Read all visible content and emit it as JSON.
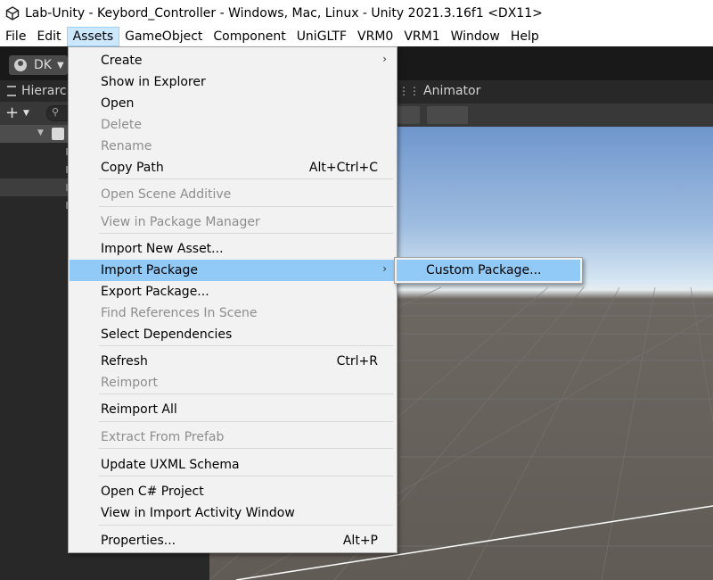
{
  "window": {
    "title": "Lab-Unity - Keybord_Controller - Windows, Mac, Linux - Unity 2021.3.16f1 <DX11>"
  },
  "menubar": {
    "items": [
      "File",
      "Edit",
      "Assets",
      "GameObject",
      "Component",
      "UniGLTF",
      "VRM0",
      "VRM1",
      "Window",
      "Help"
    ],
    "active": "Assets"
  },
  "toolbar": {
    "account_label": "DK"
  },
  "hierarchy": {
    "tab_label": "Hierarc"
  },
  "scene": {
    "animator_tab_label": "Animator"
  },
  "assets_menu": {
    "items": [
      {
        "label": "Create",
        "submenu": true
      },
      {
        "label": "Show in Explorer"
      },
      {
        "label": "Open"
      },
      {
        "label": "Delete",
        "disabled": true
      },
      {
        "label": "Rename",
        "disabled": true
      },
      {
        "label": "Copy Path",
        "shortcut": "Alt+Ctrl+C"
      },
      {
        "label": "Open Scene Additive",
        "disabled": true
      },
      {
        "label": "View in Package Manager",
        "disabled": true
      },
      {
        "label": "Import New Asset..."
      },
      {
        "label": "Import Package",
        "submenu": true,
        "highlighted": true
      },
      {
        "label": "Export Package..."
      },
      {
        "label": "Find References In Scene",
        "disabled": true
      },
      {
        "label": "Select Dependencies"
      },
      {
        "label": "Refresh",
        "shortcut": "Ctrl+R"
      },
      {
        "label": "Reimport",
        "disabled": true
      },
      {
        "label": "Reimport All"
      },
      {
        "label": "Extract From Prefab",
        "disabled": true
      },
      {
        "label": "Update UXML Schema"
      },
      {
        "label": "Open C# Project"
      },
      {
        "label": "View in Import Activity Window"
      },
      {
        "label": "Properties...",
        "shortcut": "Alt+P"
      }
    ]
  },
  "import_package_submenu": {
    "items": [
      {
        "label": "Custom Package...",
        "highlighted": true
      }
    ]
  },
  "colors": {
    "menu_highlight": "#91c9f7",
    "menubar_active": "#cce8ff",
    "disabled_text": "#8d8d8d",
    "sky_top": "#6f96cc",
    "ground": "#615b56"
  }
}
